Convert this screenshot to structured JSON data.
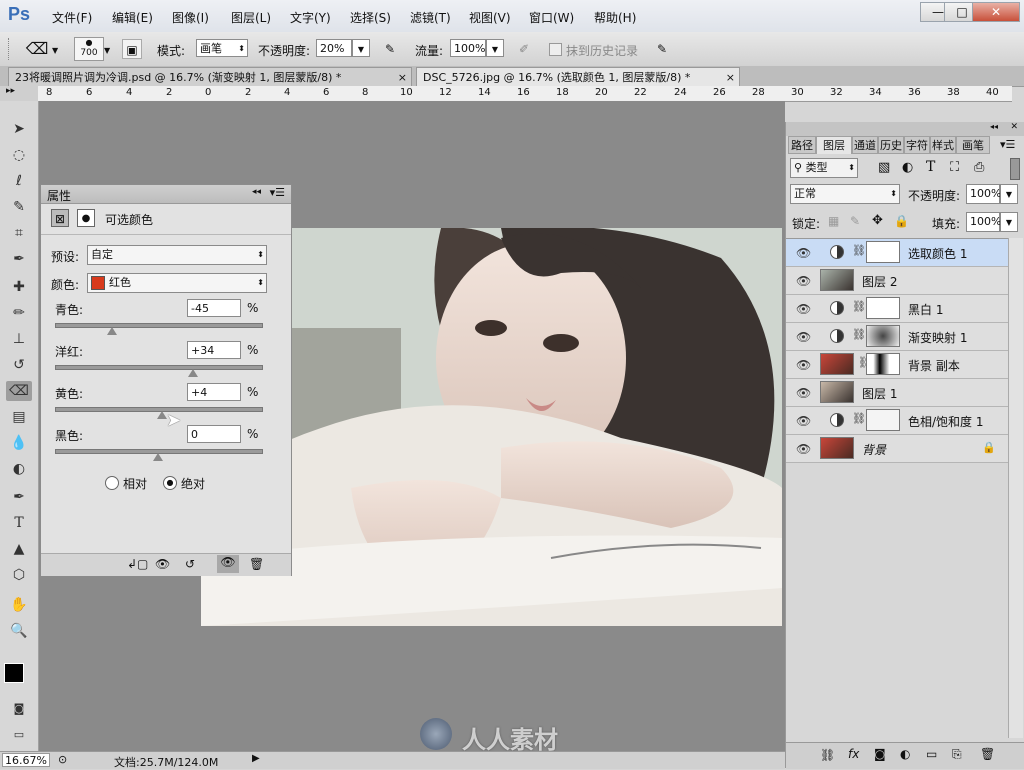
{
  "app": {
    "logo": "Ps"
  },
  "menu": [
    "文件(F)",
    "编辑(E)",
    "图像(I)",
    "图层(L)",
    "文字(Y)",
    "选择(S)",
    "滤镜(T)",
    "视图(V)",
    "窗口(W)",
    "帮助(H)"
  ],
  "window_controls": {
    "minimize": "—",
    "maximize": "□",
    "close": "✕"
  },
  "options": {
    "brush_size": "700",
    "mode_label": "模式:",
    "mode_value": "画笔",
    "opacity_label": "不透明度:",
    "opacity_value": "20%",
    "flow_label": "流量:",
    "flow_value": "100%",
    "erase_history_label": "抹到历史记录"
  },
  "tabs": [
    {
      "label": "23将暖调照片调为冷调.psd @ 16.7% (渐变映射 1, 图层蒙版/8) *",
      "close": "×"
    },
    {
      "label": "DSC_5726.jpg @ 16.7% (选取颜色 1, 图层蒙版/8) *",
      "close": "×"
    }
  ],
  "ruler_ticks": [
    "8",
    "6",
    "4",
    "2",
    "0",
    "2",
    "4",
    "6",
    "8",
    "10",
    "12",
    "14",
    "16",
    "18",
    "20",
    "22",
    "24",
    "26",
    "28",
    "30",
    "32",
    "34",
    "36",
    "38",
    "40"
  ],
  "properties": {
    "title": "属性",
    "panel_name": "可选颜色",
    "preset_label": "预设:",
    "preset_value": "自定",
    "color_label": "颜色:",
    "color_value": "红色",
    "color_swatch": "#d83a1c",
    "sliders": [
      {
        "label": "青色:",
        "value": "-45",
        "unit": "%",
        "level": -0.45
      },
      {
        "label": "洋红:",
        "value": "+34",
        "unit": "%",
        "level": 0.34
      },
      {
        "label": "黄色:",
        "value": "+4",
        "unit": "%",
        "level": 0.04
      },
      {
        "label": "黑色:",
        "value": "0",
        "unit": "%",
        "level": 0
      }
    ],
    "method_relative": "相对",
    "method_absolute": "绝对",
    "method_selected": "绝对"
  },
  "layers_panel": {
    "tabs": [
      "路径",
      "图层",
      "通道",
      "历史",
      "字符",
      "样式",
      "画笔"
    ],
    "active_tab": "图层",
    "filter_label": "类型",
    "blend_mode": "正常",
    "opacity_label": "不透明度:",
    "opacity_value": "100%",
    "lock_label": "锁定:",
    "fill_label": "填充:",
    "fill_value": "100%",
    "layers": [
      {
        "name": "选取颜色 1",
        "type": "adjustment",
        "selected": true
      },
      {
        "name": "图层 2",
        "type": "pixel",
        "selected": false
      },
      {
        "name": "黑白 1",
        "type": "adjustment",
        "selected": false
      },
      {
        "name": "渐变映射 1",
        "type": "adjustment",
        "selected": false
      },
      {
        "name": "背景 副本",
        "type": "pixel-mask",
        "selected": false
      },
      {
        "name": "图层 1",
        "type": "pixel",
        "selected": false
      },
      {
        "name": "色相/饱和度 1",
        "type": "adjustment",
        "selected": false
      },
      {
        "name": "背景",
        "type": "background",
        "selected": false
      }
    ]
  },
  "status": {
    "zoom": "16.67%",
    "doc_info": "文档:25.7M/124.0M"
  },
  "watermark": "人人素材"
}
